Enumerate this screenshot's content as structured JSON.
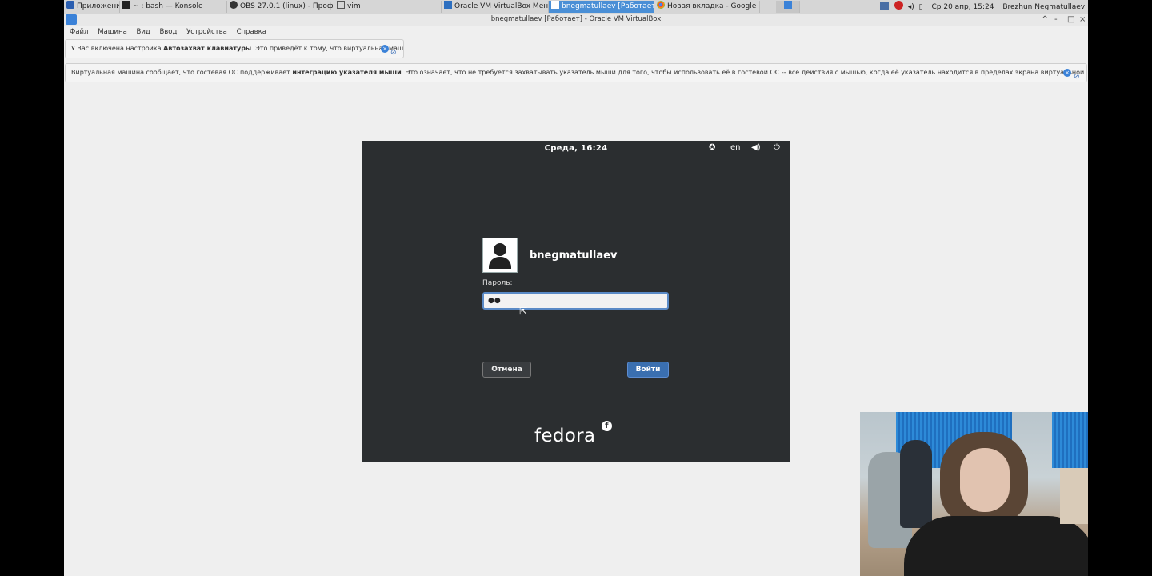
{
  "taskbar": {
    "items": [
      {
        "label": "Приложения",
        "icon": "app-menu-icon"
      },
      {
        "label": "~ : bash — Konsole",
        "icon": "terminal-icon"
      },
      {
        "label": "OBS 27.0.1 (linux) - Проф...",
        "icon": "obs-icon"
      },
      {
        "label": "vim",
        "icon": "vim-icon"
      },
      {
        "label": "Oracle VM VirtualBox Мен...",
        "icon": "virtualbox-icon"
      },
      {
        "label": "bnegmatullaev [Работает] ...",
        "icon": "virtualbox-icon",
        "active": true
      },
      {
        "label": "Новая вкладка - Google ...",
        "icon": "chrome-icon"
      }
    ],
    "datetime": "Ср 20 апр, 15:24",
    "user": "Brezhun  Negmatullaev"
  },
  "window": {
    "title": "bnegmatullaev [Работает] - Oracle VM VirtualBox",
    "controls": [
      "^",
      "-",
      "□",
      "×"
    ]
  },
  "menu": [
    "Файл",
    "Машина",
    "Вид",
    "Ввод",
    "Устройства",
    "Справка"
  ],
  "notice1": {
    "prefix": "У Вас включена настройка ",
    "bold": "Автозахват клавиатуры",
    "suffix": ". Это приведёт к тому, что виртуальная машина"
  },
  "notice2": {
    "prefix": "Виртуальная машина сообщает, что гостевая ОС поддерживает ",
    "bold": "интеграцию указателя мыши",
    "suffix": ". Это означает, что не требуется захватывать указатель мыши для того, чтобы использовать её в гостевой ОС -- все действия с мышью, когда её указатель находится в пределах экрана виртуальной машины, напрямую передаются в"
  },
  "vm": {
    "clock": "Среда, 16:24",
    "lang": "en",
    "username": "bnegmatullaev",
    "password_label": "Пароль:",
    "password_value": "●●",
    "cancel_label": "Отмена",
    "login_label": "Войти",
    "logo": "fedora"
  },
  "colors": {
    "accent": "#3a6fb0",
    "vm_bg": "#2b2e30",
    "active_task": "#4a8fd6"
  }
}
